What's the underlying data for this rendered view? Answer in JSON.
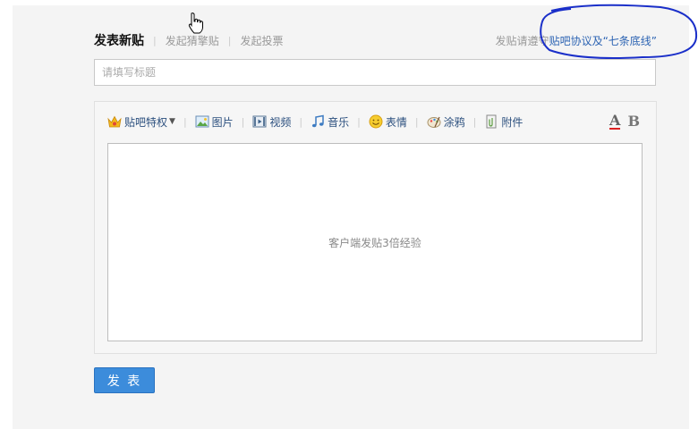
{
  "tabs": {
    "active": "发表新贴",
    "items": [
      "发起猜擎贴",
      "发起投票"
    ]
  },
  "notice": {
    "prefix": "发贴请遵守",
    "link": "贴吧协议及“七条底线”"
  },
  "title_input": {
    "placeholder": "请填写标题",
    "value": ""
  },
  "toolbar": {
    "items": [
      {
        "label": "贴吧特权",
        "icon": "crown-icon",
        "has_dropdown": true
      },
      {
        "label": "图片",
        "icon": "image-icon"
      },
      {
        "label": "视频",
        "icon": "video-icon"
      },
      {
        "label": "音乐",
        "icon": "music-icon"
      },
      {
        "label": "表情",
        "icon": "smiley-icon"
      },
      {
        "label": "涂鸦",
        "icon": "paint-icon"
      },
      {
        "label": "附件",
        "icon": "attachment-icon"
      }
    ],
    "format_a": "A",
    "format_b": "B"
  },
  "editor": {
    "placeholder": "客户端发贴3倍经验"
  },
  "submit_label": "发 表",
  "colors": {
    "link": "#2d64b3",
    "button": "#3c8cdb",
    "annotation": "#1a2fc9"
  }
}
